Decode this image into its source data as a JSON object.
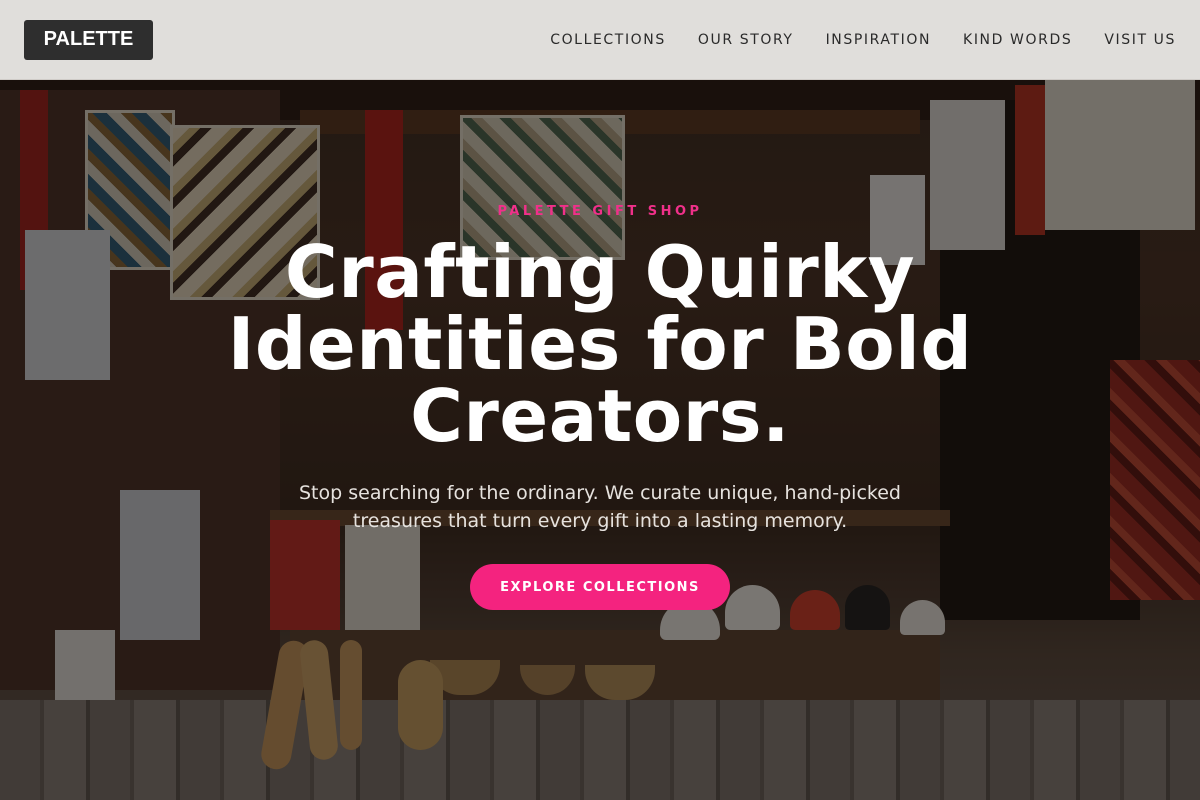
{
  "header": {
    "logo": "PALETTE",
    "nav": [
      {
        "label": "COLLECTIONS"
      },
      {
        "label": "OUR STORY"
      },
      {
        "label": "INSPIRATION"
      },
      {
        "label": "KIND WORDS"
      },
      {
        "label": "VISIT US"
      }
    ]
  },
  "hero": {
    "eyebrow": "PALETTE GIFT SHOP",
    "headline": "Crafting Quirky Identities for Bold Creators.",
    "subhead": "Stop searching for the ordinary. We curate unique, hand-picked treasures that turn every gift into a lasting memory.",
    "cta_label": "EXPLORE COLLECTIONS",
    "background_image": "market-stall-photo"
  },
  "colors": {
    "accent": "#f4237f",
    "eyebrow": "#f0308a",
    "logo_bg": "#2e2e2e",
    "header_bg": "#e8e6e4"
  }
}
